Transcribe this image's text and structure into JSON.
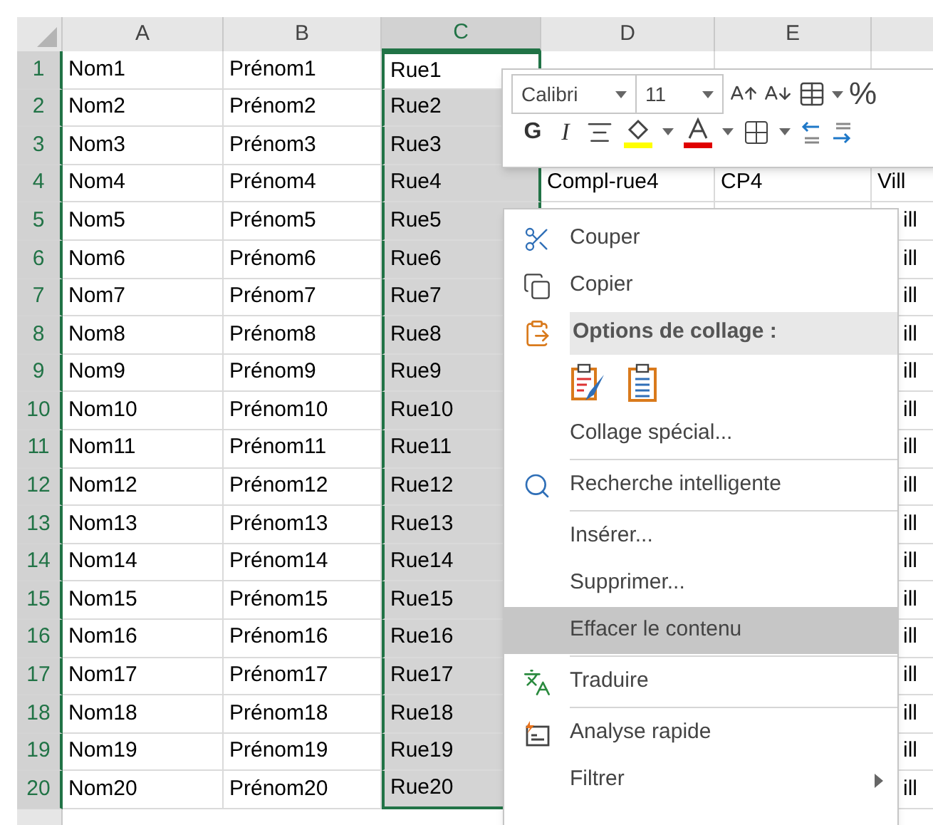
{
  "columns": [
    {
      "label": "A",
      "selected": false
    },
    {
      "label": "B",
      "selected": false
    },
    {
      "label": "C",
      "selected": true
    },
    {
      "label": "D",
      "selected": false
    },
    {
      "label": "E",
      "selected": false
    }
  ],
  "rows": [
    {
      "number": "1",
      "selected": true,
      "active": true,
      "cells": [
        "Nom1",
        "Prénom1",
        "Rue1",
        null,
        null,
        null
      ]
    },
    {
      "number": "2",
      "selected": true,
      "active": false,
      "cells": [
        "Nom2",
        "Prénom2",
        "Rue2",
        null,
        null,
        null
      ]
    },
    {
      "number": "3",
      "selected": true,
      "active": false,
      "cells": [
        "Nom3",
        "Prénom3",
        "Rue3",
        null,
        null,
        null
      ]
    },
    {
      "number": "4",
      "selected": true,
      "active": false,
      "cells": [
        "Nom4",
        "Prénom4",
        "Rue4",
        "Compl-rue4",
        "CP4",
        "Vill"
      ]
    },
    {
      "number": "5",
      "selected": true,
      "active": false,
      "cells": [
        "Nom5",
        "Prénom5",
        "Rue5",
        null,
        null,
        "ill"
      ]
    },
    {
      "number": "6",
      "selected": true,
      "active": false,
      "cells": [
        "Nom6",
        "Prénom6",
        "Rue6",
        null,
        null,
        "ill"
      ]
    },
    {
      "number": "7",
      "selected": true,
      "active": false,
      "cells": [
        "Nom7",
        "Prénom7",
        "Rue7",
        null,
        null,
        "ill"
      ]
    },
    {
      "number": "8",
      "selected": true,
      "active": false,
      "cells": [
        "Nom8",
        "Prénom8",
        "Rue8",
        null,
        null,
        "ill"
      ]
    },
    {
      "number": "9",
      "selected": true,
      "active": false,
      "cells": [
        "Nom9",
        "Prénom9",
        "Rue9",
        null,
        null,
        "ill"
      ]
    },
    {
      "number": "10",
      "selected": true,
      "active": false,
      "cells": [
        "Nom10",
        "Prénom10",
        "Rue10",
        null,
        null,
        "ill"
      ]
    },
    {
      "number": "11",
      "selected": true,
      "active": false,
      "cells": [
        "Nom11",
        "Prénom11",
        "Rue11",
        null,
        null,
        "ill"
      ]
    },
    {
      "number": "12",
      "selected": true,
      "active": false,
      "cells": [
        "Nom12",
        "Prénom12",
        "Rue12",
        null,
        null,
        "ill"
      ]
    },
    {
      "number": "13",
      "selected": true,
      "active": false,
      "cells": [
        "Nom13",
        "Prénom13",
        "Rue13",
        null,
        null,
        "ill"
      ]
    },
    {
      "number": "14",
      "selected": true,
      "active": false,
      "cells": [
        "Nom14",
        "Prénom14",
        "Rue14",
        null,
        null,
        "ill"
      ]
    },
    {
      "number": "15",
      "selected": true,
      "active": false,
      "cells": [
        "Nom15",
        "Prénom15",
        "Rue15",
        null,
        null,
        "ill"
      ]
    },
    {
      "number": "16",
      "selected": true,
      "active": false,
      "cells": [
        "Nom16",
        "Prénom16",
        "Rue16",
        null,
        null,
        "ill"
      ]
    },
    {
      "number": "17",
      "selected": true,
      "active": false,
      "cells": [
        "Nom17",
        "Prénom17",
        "Rue17",
        null,
        null,
        "ill"
      ]
    },
    {
      "number": "18",
      "selected": true,
      "active": false,
      "cells": [
        "Nom18",
        "Prénom18",
        "Rue18",
        null,
        null,
        "ill"
      ]
    },
    {
      "number": "19",
      "selected": true,
      "active": false,
      "cells": [
        "Nom19",
        "Prénom19",
        "Rue19",
        null,
        null,
        "ill"
      ]
    },
    {
      "number": "20",
      "selected": true,
      "active": false,
      "cells": [
        "Nom20",
        "Prénom20",
        "Rue20",
        null,
        null,
        "ill"
      ]
    }
  ],
  "mini_toolbar": {
    "font": "Calibri",
    "size": "11",
    "percent": "%",
    "bold": "G",
    "italic": "I"
  },
  "context_menu": [
    {
      "kind": "item",
      "label": "Couper",
      "selected": false,
      "submenu": false
    },
    {
      "kind": "item",
      "label": "Copier",
      "selected": false,
      "submenu": false
    },
    {
      "kind": "header",
      "label": "Options de collage :"
    },
    {
      "kind": "paste-options"
    },
    {
      "kind": "item",
      "label": "Collage spécial...",
      "selected": false,
      "submenu": false
    },
    {
      "kind": "separator"
    },
    {
      "kind": "item",
      "label": "Recherche intelligente",
      "selected": false,
      "submenu": false
    },
    {
      "kind": "separator"
    },
    {
      "kind": "item",
      "label": "Insérer...",
      "selected": false,
      "submenu": false
    },
    {
      "kind": "item",
      "label": "Supprimer...",
      "selected": false,
      "submenu": false
    },
    {
      "kind": "item",
      "label": "Effacer le contenu",
      "selected": true,
      "submenu": false
    },
    {
      "kind": "separator"
    },
    {
      "kind": "item",
      "label": "Traduire",
      "selected": false,
      "submenu": false
    },
    {
      "kind": "separator"
    },
    {
      "kind": "item",
      "label": "Analyse rapide",
      "selected": false,
      "submenu": false
    },
    {
      "kind": "item",
      "label": "Filtrer",
      "selected": false,
      "submenu": true
    }
  ]
}
